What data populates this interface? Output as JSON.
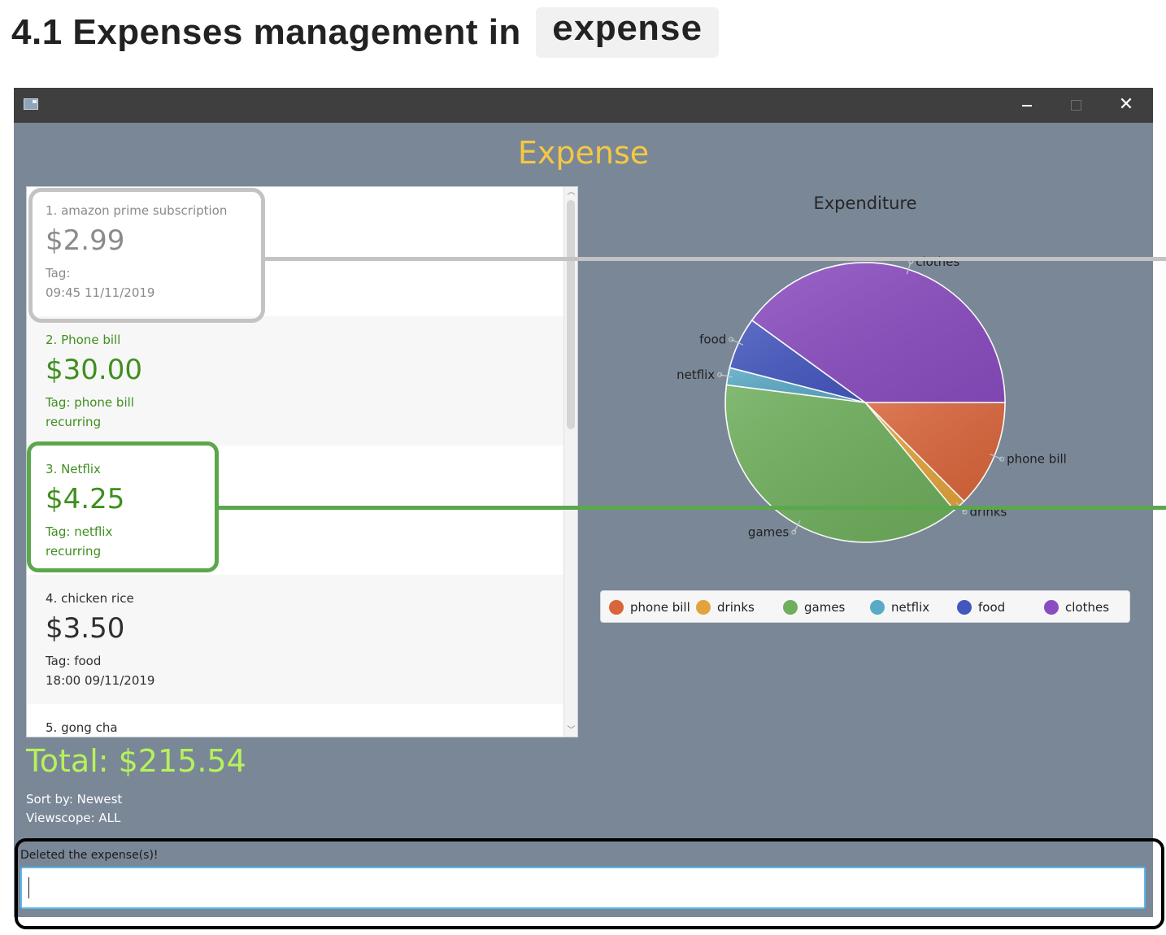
{
  "doc_heading": {
    "text": "4.1 Expenses management in",
    "code": "expense"
  },
  "window": {
    "app_icon": "window-app-icon",
    "controls": {
      "minimize": "minimize-icon",
      "maximize": "maximize-icon",
      "close_glyph": "✕"
    },
    "title": "Expense"
  },
  "expenses": [
    {
      "name": "1. amazon prime subscription",
      "amount": "$2.99",
      "tag": "Tag:",
      "extra": "09:45 11/11/2019",
      "color": "#8a8a8a"
    },
    {
      "name": "2. Phone bill",
      "amount": "$30.00",
      "tag": "Tag: phone bill",
      "extra": "recurring",
      "color": "#3f8f1f"
    },
    {
      "name": "3. Netflix",
      "amount": "$4.25",
      "tag": "Tag: netflix",
      "extra": "recurring",
      "color": "#3f8f1f"
    },
    {
      "name": "4. chicken rice",
      "amount": "$3.50",
      "tag": "Tag: food",
      "extra": "18:00 09/11/2019",
      "color": "#2f2f2f"
    },
    {
      "name": "5. gong cha",
      "amount": "",
      "tag": "",
      "extra": "",
      "color": "#2f2f2f"
    }
  ],
  "summary": {
    "total": "Total: $215.54",
    "sort": "Sort by: Newest",
    "viewscope": "Viewscope: ALL"
  },
  "command": {
    "result": "Deleted the expense(s)!",
    "input_value": ""
  },
  "chart_data": {
    "type": "pie",
    "title": "Expenditure",
    "categories": [
      "phone bill",
      "drinks",
      "games",
      "netflix",
      "food",
      "clothes"
    ],
    "values": [
      12.5,
      1.5,
      38,
      2,
      6,
      40
    ],
    "colors": [
      "#d9653b",
      "#e3a33a",
      "#6eae5c",
      "#5aa9c6",
      "#4457bf",
      "#8a4cc0"
    ],
    "legend_position": "bottom"
  }
}
